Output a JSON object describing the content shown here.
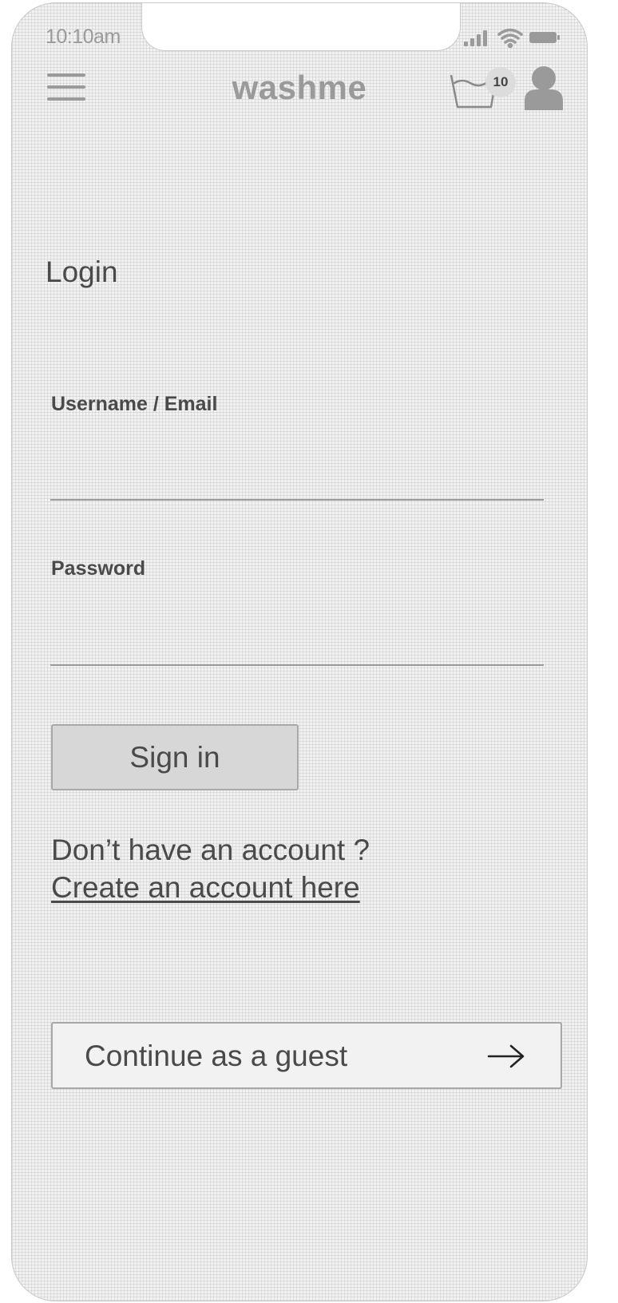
{
  "status_bar": {
    "time": "10:10am",
    "icons": [
      "signal-icon",
      "wifi-icon",
      "battery-icon"
    ]
  },
  "header": {
    "menu_icon": "hamburger-menu-icon",
    "logo": "washme",
    "basket_icon": "laundry-basket-icon",
    "basket_count": "10",
    "user_icon": "user-avatar-icon"
  },
  "login": {
    "title": "Login",
    "username_label": "Username / Email",
    "username_value": "",
    "password_label": "Password",
    "password_value": "",
    "signin_label": "Sign in",
    "no_account_text": "Don’t have an account ?",
    "create_account_link": "Create an account here",
    "guest_label": "Continue as a guest",
    "guest_icon": "arrow-right-icon"
  },
  "colors": {
    "text": "#4a4a4a",
    "muted": "#9a9a9a",
    "button_fill": "#d7d7d7",
    "background": "#f2f2f2"
  }
}
